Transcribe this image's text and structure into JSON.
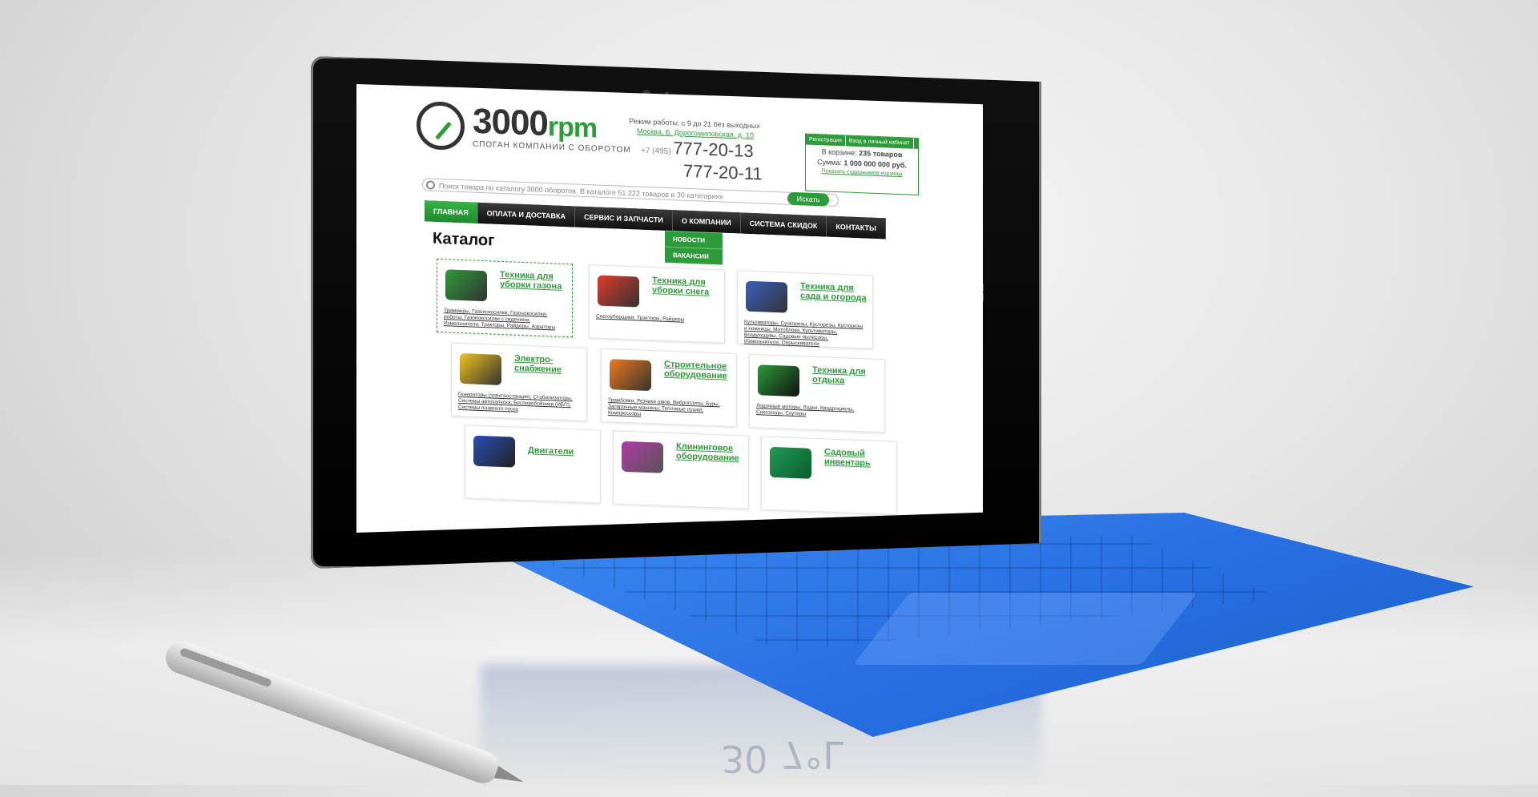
{
  "header": {
    "logo_main": "3000",
    "logo_suffix": "rpm",
    "slogan": "СПОГАН КОМПАНИИ С ОБОРОТОМ",
    "hours": "Режим работы: с 9 до 21 без выходных",
    "address": "Москва, Б. Дорогомиловская, д. 10",
    "phone_prefix": "+7 (495)",
    "phone_1": "777-20-13",
    "phone_2": "777-20-11"
  },
  "cart": {
    "tab_register": "Регистрация",
    "tab_login": "Вход в личный кабинет",
    "items_label": "В корзине:",
    "items_value": "235 товаров",
    "sum_label": "Сумма:",
    "sum_value": "1 000 000 000 руб.",
    "show_link": "Показать содержимое корзины"
  },
  "search": {
    "placeholder": "Поиск товара по каталогу 3000 оборотов. В каталоге 51 222 товаров в 30 категориях",
    "button": "Искать"
  },
  "nav": {
    "items": [
      "ГЛАВНАЯ",
      "ОПЛАТА И ДОСТАВКА",
      "СЕРВИС И ЗАПЧАСТИ",
      "О КОМПАНИИ",
      "СИСТЕМА СКИДОК",
      "КОНТАКТЫ"
    ],
    "submenu": [
      "НОВОСТИ",
      "ВАКАНСИИ"
    ]
  },
  "page_title": "Каталог",
  "categories": [
    {
      "name": "Техника для уборки газона",
      "sub": "Триммеры, Газонокосилки, Газонокосилки-роботы, Газонокосилки с сидением, Измельчители, Тракторы, Райдеры, Аэраторы"
    },
    {
      "name": "Техника для уборки снега",
      "sub": "Снегоуборщики, Тракторы, Райдеры"
    },
    {
      "name": "Техника для сада и огорода",
      "sub": "Культиваторы, Сучкорезы, Кусторезы, Кусторезы и ножницы, Мотоблоки, Культиваторы, Воздуходувы, Садовые пылесосы, Измельчители, Опрыскиватели"
    },
    {
      "name": "Электро-снабжение",
      "sub": "Генераторы (электростанции), Стабилизаторы, Системы автозапуска, Бесперебойники (ИБП), Системы плавного пуска"
    },
    {
      "name": "Строительное оборудование",
      "sub": "Трамбовки, Резчики швов, Виброплиты, Буры, Затирочные машины, Тепловые пушки, Компрессоры"
    },
    {
      "name": "Техника для отдыха",
      "sub": "Лодочные моторы, Лодки, Квадроциклы, Снегоходы, Скутеры"
    },
    {
      "name": "Двигатели",
      "sub": ""
    },
    {
      "name": "Клининговое оборудование",
      "sub": ""
    },
    {
      "name": "Садовый инвентарь",
      "sub": ""
    }
  ],
  "colors": {
    "accent": "#2e9b3a",
    "keyboard": "#2b74e6",
    "nav_bg": "#222222"
  },
  "reflection": {
    "text_a": "30",
    "text_b": "7°L"
  }
}
